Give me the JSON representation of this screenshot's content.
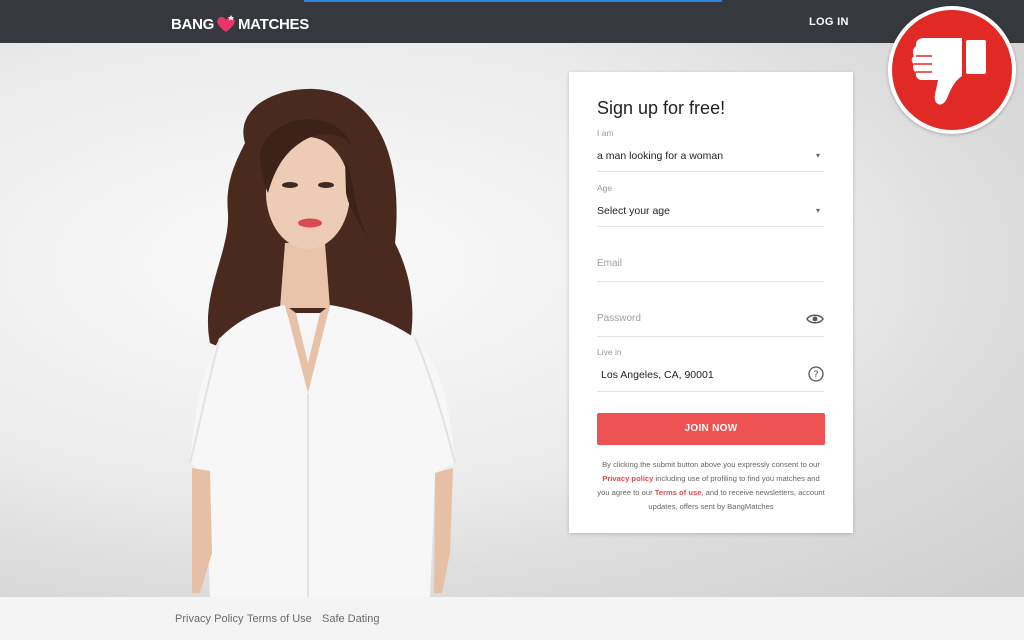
{
  "header": {
    "logo_left": "BANG",
    "logo_right": "MATCHES",
    "login_label": "LOG IN"
  },
  "form": {
    "title": "Sign up for free!",
    "iam_label": "I am",
    "iam_value": "a man looking for a woman",
    "age_label": "Age",
    "age_value": "Select your age",
    "email_placeholder": "Email",
    "password_placeholder": "Password",
    "livein_label": "Live in",
    "livein_value": "Los Angeles, CA, 90001",
    "join_label": "JOIN NOW",
    "legal": {
      "part1": "By clicking the submit button above you expressly consent to our ",
      "privacy_link": "Privacy policy",
      "part2": " including use of profiling to find you matches and you agree to our ",
      "terms_link": "Terms of use",
      "part3": ", and to receive newsletters, account updates, offers sent by BangMatches"
    }
  },
  "footer": {
    "links": [
      "Privacy Policy",
      "Terms of Use",
      "Safe Dating"
    ]
  },
  "icons": {
    "dropdown": "caret-down-icon",
    "password_toggle": "eye-icon",
    "location_help": "question-circle-icon",
    "badge": "thumbs-down-icon"
  },
  "colors": {
    "header_bg": "#35393e",
    "accent_blue": "#2f80d8",
    "button_red": "#ee5253",
    "badge_red": "#e12a26",
    "link_red": "#e04b4c"
  }
}
